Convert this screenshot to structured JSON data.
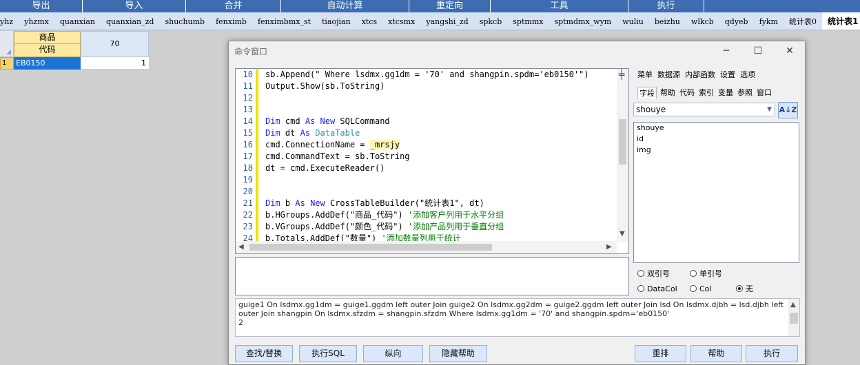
{
  "top_menu": [
    "导出",
    "导入",
    "合并",
    "自动计算",
    "重定向",
    "工具",
    "执行"
  ],
  "tabs": [
    "yhz",
    "yhzmx",
    "quanxian",
    "quanxian_zd",
    "shuchumb",
    "fenximb",
    "fenximbmx_st",
    "tiaojian",
    "xtcs",
    "xtcsmx",
    "yangshi_zd",
    "spkcb",
    "sptmmx",
    "sptmdmx_wym",
    "wuliu",
    "beizhu",
    "wlkcb",
    "qdyeb",
    "fykm",
    "统计表0",
    "统计表1"
  ],
  "active_tab": "统计表1",
  "grid": {
    "header_top": "商品",
    "header_bottom": "代码",
    "header_value": "70",
    "row_number": "1",
    "code_cell": "EB0150",
    "value_cell": "1"
  },
  "dialog": {
    "title": "命令窗口",
    "minimize": "─",
    "maximize": "☐",
    "close": "✕",
    "line_numbers": [
      "10",
      "11",
      "12",
      "13",
      "14",
      "15",
      "16",
      "17",
      "18",
      "19",
      "20",
      "21",
      "22",
      "23",
      "24"
    ],
    "right_tabs_row1": [
      "菜单",
      "数据源",
      "内部函数",
      "设置",
      "选项"
    ],
    "right_tabs_row2": [
      "字段",
      "帮助",
      "代码",
      "索引",
      "变量",
      "参照",
      "窗口"
    ],
    "selected_right_tab": "字段",
    "field_select": "shouye",
    "sort_label": "A↓Z",
    "fields": [
      "shouye",
      "id",
      "img"
    ],
    "radios": [
      {
        "label": "双引号",
        "checked": false
      },
      {
        "label": "单引号",
        "checked": false
      },
      {
        "label": "DataCol",
        "checked": false
      },
      {
        "label": "Col",
        "checked": false
      },
      {
        "label": "无",
        "checked": true
      }
    ],
    "output_text": "guige1 On lsdmx.gg1dm = guige1.ggdm left outer Join guige2 On lsdmx.gg2dm = guige2.ggdm left outer Join lsd On lsdmx.djbh = lsd.djbh left outer Join shangpin On lsdmx.sfzdm = shangpin.sfzdm Where lsdmx.gg1dm = '70' and shangpin.spdm='eb0150'",
    "output_result": "2",
    "buttons_left": [
      "查找/替换",
      "执行SQL",
      "纵向",
      "隐藏帮助"
    ],
    "buttons_right": [
      "重排",
      "帮助",
      "执行"
    ]
  }
}
